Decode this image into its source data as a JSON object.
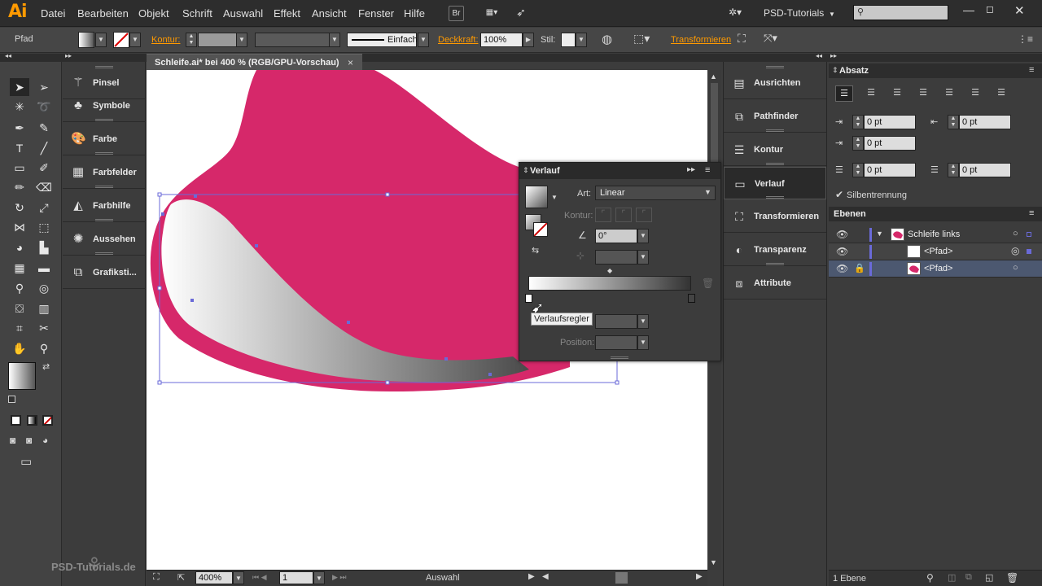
{
  "menubar": {
    "logo": "Ai",
    "items": [
      "Datei",
      "Bearbeiten",
      "Objekt",
      "Schrift",
      "Auswahl",
      "Effekt",
      "Ansicht",
      "Fenster",
      "Hilfe"
    ],
    "br_label": "Br",
    "workspace": "PSD-Tutorials",
    "search_placeholder": ""
  },
  "controlbar": {
    "object_type": "Pfad",
    "kontur_label": "Kontur:",
    "stroke_style": "Einfach",
    "deckkraft_label": "Deckkraft:",
    "deckkraft_value": "100%",
    "stil_label": "Stil:",
    "transform_label": "Transformieren"
  },
  "document": {
    "tab_title": "Schleife.ai* bei 400 % (RGB/GPU-Vorschau)",
    "close": "×"
  },
  "left_panels": [
    "Pinsel",
    "Symbole",
    "Farbe",
    "Farbfelder",
    "Farbhilfe",
    "Aussehen",
    "Grafiksti..."
  ],
  "middle_panels": [
    "Ausrichten",
    "Pathfinder",
    "Kontur",
    "Verlauf",
    "Transformieren",
    "Transparenz",
    "Attribute"
  ],
  "verlauf_panel": {
    "title": "Verlauf",
    "art_label": "Art:",
    "art_value": "Linear",
    "kontur_label": "Kontur:",
    "angle_value": "0°",
    "position_label": "Position:",
    "tooltip": "Verlaufsregler"
  },
  "absatz": {
    "title": "Absatz",
    "indent_left": "0 pt",
    "indent_right": "0 pt",
    "first_line": "0 pt",
    "space_before": "0 pt",
    "space_after": "0 pt",
    "hyphenation": "Silbentrennung"
  },
  "ebenen": {
    "title": "Ebenen",
    "layer_name": "Schleife links",
    "items": [
      "<Pfad>",
      "<Pfad>"
    ],
    "footer": "1 Ebene"
  },
  "statusbar": {
    "zoom": "400%",
    "artboard": "1",
    "tool": "Auswahl"
  },
  "watermark": "PSD-Tutorials.de",
  "colors": {
    "shape_fill": "#d6286a",
    "accent_orange": "#ff9a00",
    "selection_blue": "#6a6ad8"
  }
}
